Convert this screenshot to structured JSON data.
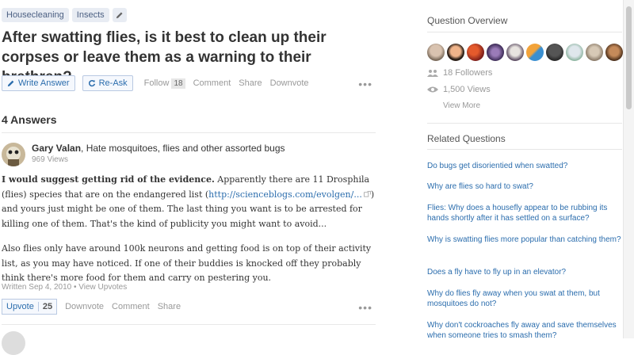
{
  "topics": [
    "Housecleaning",
    "Insects"
  ],
  "question": {
    "title": "After swatting flies, is it best to clean up their corpses or leave them as a warning to their brethren?"
  },
  "actions": {
    "write_answer": "Write Answer",
    "reask": "Re-Ask",
    "follow": "Follow",
    "follow_count": "18",
    "comment": "Comment",
    "share": "Share",
    "downvote": "Downvote",
    "more": "•••"
  },
  "answers_heading": "4 Answers",
  "answer": {
    "author_name": "Gary Valan",
    "author_bio": ", Hate mosquitoes, flies and other assorted bugs",
    "views": "969 Views",
    "bold_lead": "I would suggest getting rid of the evidence.",
    "p1_a": " Apparently there are 11 Drosphila (flies) species that are on the endangered list (",
    "link": "http://scienceblogs.com/evolgen/...",
    "p1_b": ") and yours just might be one of them. The last thing you want is to be arrested for killing one of them. That's the kind of publicity you might want to avoid...",
    "p2": "Also flies only have around 100k neurons and getting food is on top of their activity list, as you may have noticed. If one of their buddies is knocked off they probably think there's more food for them and carry on pestering you.",
    "written": "Written Sep 4, 2010 • View Upvotes",
    "upvote": "Upvote",
    "upvote_count": "25",
    "downvote": "Downvote",
    "comment": "Comment",
    "share": "Share"
  },
  "sidebar": {
    "overview_title": "Question Overview",
    "followers": "18 Followers",
    "views": "1,500 Views",
    "view_more": "View More",
    "related_title": "Related Questions",
    "related": [
      "Do bugs get disorientied when swatted?",
      "Why are flies so hard to swat?",
      "Flies: Why does a housefly appear to be rubbing its hands shortly after it has settled on a surface?",
      "Why is swatting flies more popular than catching them?",
      "Does a fly have to fly up in an elevator?",
      "Why do flies fly away when you swat at them, but mosquitoes do not?",
      "Why don't cockroaches fly away and save themselves when someone tries to smash them?"
    ]
  },
  "colors": {
    "link": "#2b6dad",
    "muted": "#999999",
    "chip_bg": "#e8ecf3"
  }
}
